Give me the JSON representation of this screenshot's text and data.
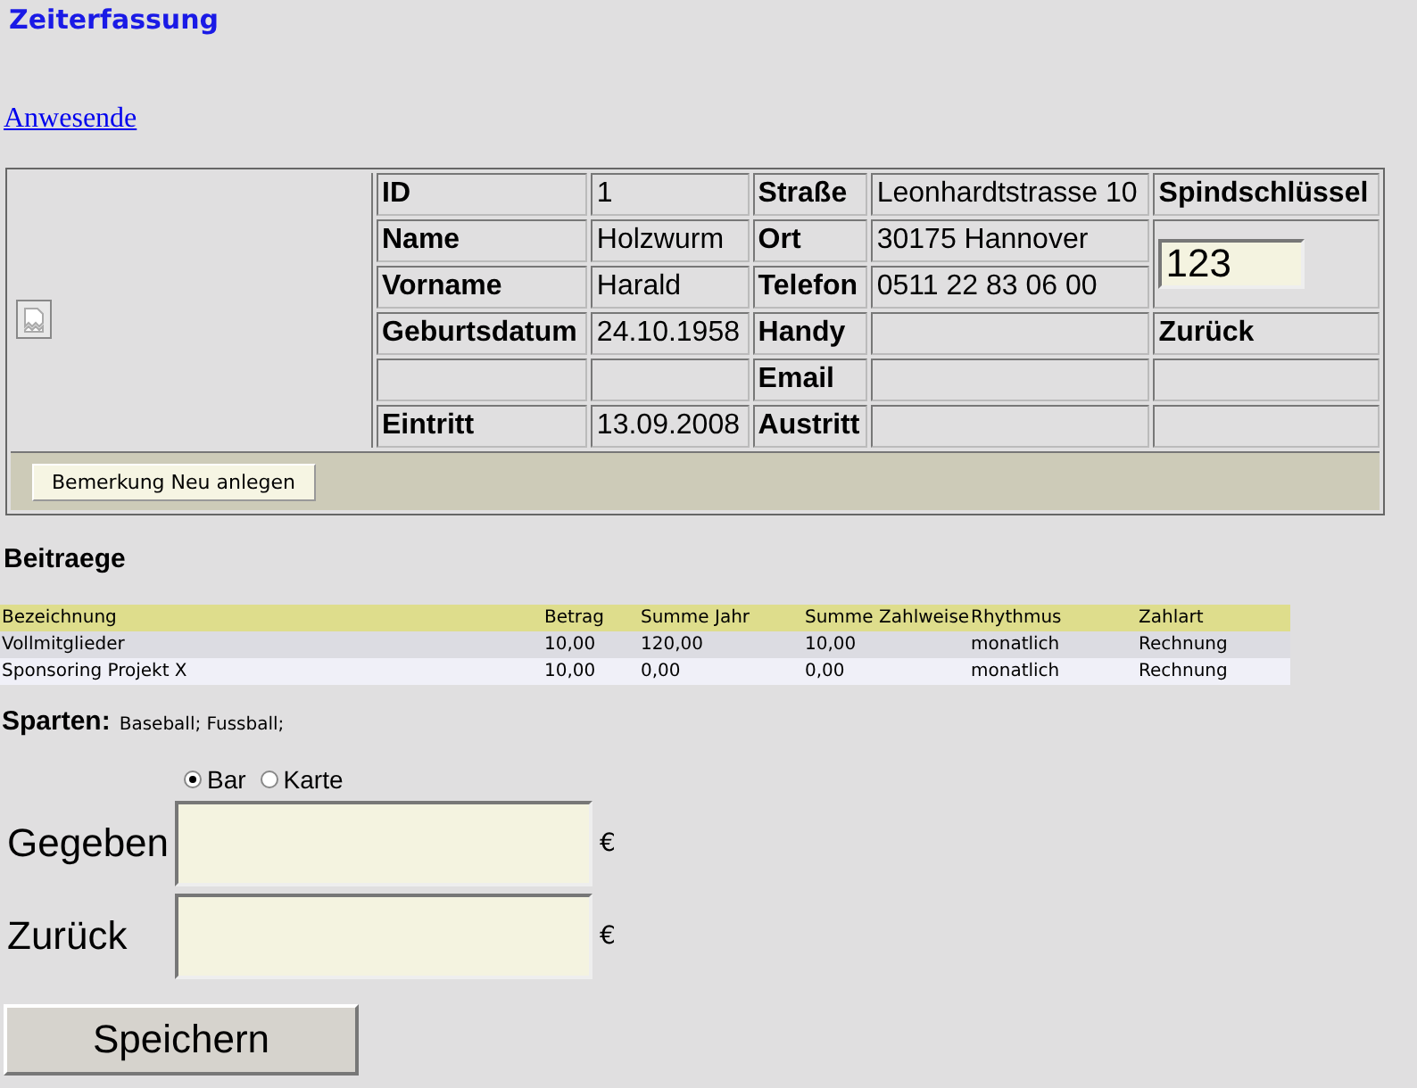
{
  "title": "Zeiterfassung",
  "link": "Anwesende",
  "member": {
    "rows": [
      [
        {
          "kind": "label",
          "text": "ID"
        },
        {
          "kind": "value",
          "text": "1"
        },
        {
          "kind": "label",
          "text": "Straße"
        },
        {
          "kind": "value",
          "text": "Leonhardtstrasse 10"
        },
        {
          "kind": "label",
          "text": "Spindschlüssel"
        }
      ],
      [
        {
          "kind": "label",
          "text": "Name"
        },
        {
          "kind": "value",
          "text": "Holzwurm"
        },
        {
          "kind": "label",
          "text": "Ort"
        },
        {
          "kind": "value",
          "text": "30175 Hannover"
        },
        {
          "kind": "input",
          "value": "123",
          "rowspan": 2
        }
      ],
      [
        {
          "kind": "label",
          "text": "Vorname"
        },
        {
          "kind": "value",
          "text": "Harald"
        },
        {
          "kind": "label",
          "text": "Telefon"
        },
        {
          "kind": "value",
          "text": "0511 22 83 06 00"
        }
      ],
      [
        {
          "kind": "label",
          "text": "Geburtsdatum"
        },
        {
          "kind": "value",
          "text": "24.10.1958"
        },
        {
          "kind": "label",
          "text": "Handy"
        },
        {
          "kind": "empty"
        },
        {
          "kind": "label",
          "text": "Zurück"
        }
      ],
      [
        {
          "kind": "empty"
        },
        {
          "kind": "empty"
        },
        {
          "kind": "label",
          "text": "Email"
        },
        {
          "kind": "empty"
        },
        {
          "kind": "empty"
        }
      ],
      [
        {
          "kind": "label",
          "text": "Eintritt"
        },
        {
          "kind": "value",
          "text": "13.09.2008"
        },
        {
          "kind": "label",
          "text": "Austritt"
        },
        {
          "kind": "empty"
        },
        {
          "kind": "empty"
        }
      ]
    ],
    "button": "Bemerkung Neu anlegen"
  },
  "beitraege": {
    "heading": "Beitraege",
    "columns": [
      "Bezeichnung",
      "Betrag",
      "Summe Jahr",
      "Summe Zahlweise",
      "Rhythmus",
      "Zahlart"
    ],
    "rows": [
      [
        "Vollmitglieder",
        "10,00",
        "120,00",
        "10,00",
        "monatlich",
        "Rechnung"
      ],
      [
        "Sponsoring Projekt X",
        "10,00",
        "0,00",
        "0,00",
        "monatlich",
        "Rechnung"
      ]
    ]
  },
  "sparten": {
    "label": "Sparten:",
    "value": "Baseball; Fussball;"
  },
  "payment": {
    "options": [
      {
        "label": "Bar",
        "selected": true
      },
      {
        "label": "Karte",
        "selected": false
      }
    ],
    "fields": [
      {
        "label": "Gegeben",
        "currency": "€"
      },
      {
        "label": "Zurück",
        "currency": "€"
      }
    ],
    "save": "Speichern"
  }
}
